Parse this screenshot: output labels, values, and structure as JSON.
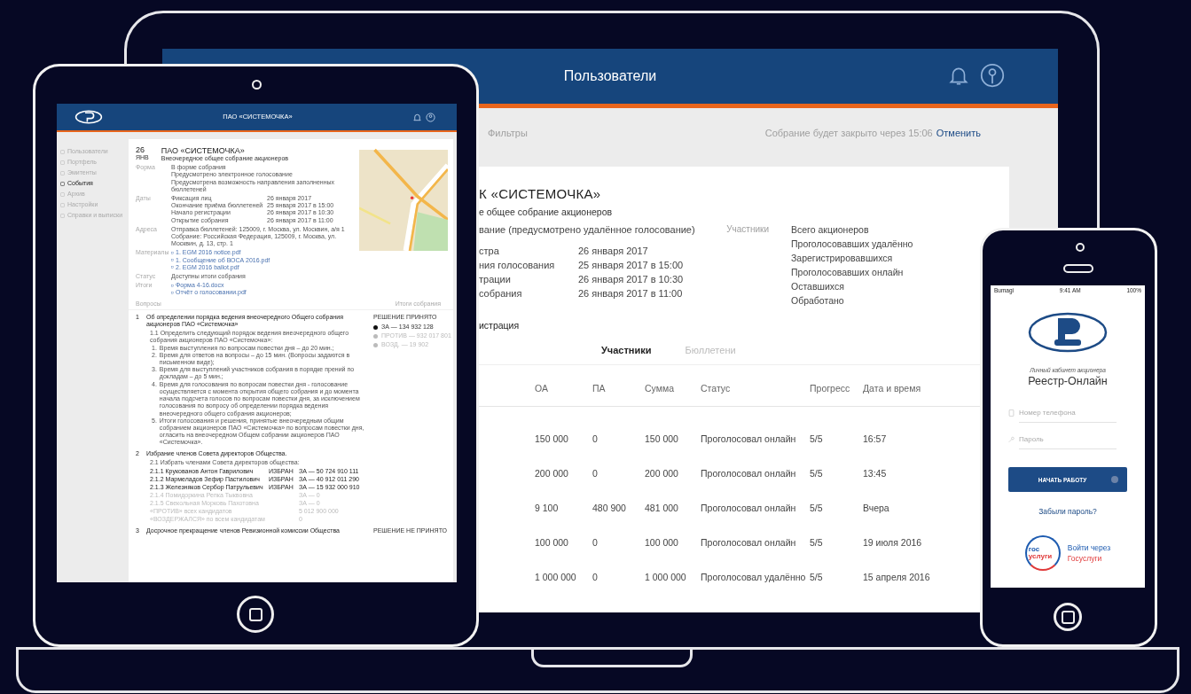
{
  "laptop": {
    "header_title": "Пользователи",
    "filters_label": "Фильтры",
    "timer_text": "Собрание будет закрыто через 15:06",
    "cancel_link": "Отменить",
    "meeting_title": "К «СИСТЕМОЧКА»",
    "meeting_subtitle": "е общее собрание акционеров",
    "meeting_form": "вание (предусмотрено удалённое голосование)",
    "participants_label": "Участники",
    "dates": [
      {
        "label": "стра",
        "value": "26 января 2017"
      },
      {
        "label": "ния голосования",
        "value": "25 января 2017 в 15:00"
      },
      {
        "label": "трации",
        "value": "26 января 2017 в 10:30"
      },
      {
        "label": "собрания",
        "value": "26 января 2017 в 11:00"
      }
    ],
    "section_label": "истрация",
    "stats": [
      "Всего акционеров",
      "Проголосовавших удалённо",
      "Зарегистрировавшихся",
      "Проголосовавших онлайн",
      "Оставшихся",
      "Обработано"
    ],
    "tabs": [
      {
        "label": "Участники",
        "selected": true
      },
      {
        "label": "Бюллетени",
        "selected": false
      }
    ],
    "table": {
      "columns": [
        "ОА",
        "ПА",
        "Сумма",
        "Статус",
        "Прогресс",
        "Дата и время"
      ],
      "rows": [
        [
          "150 000",
          "0",
          "150 000",
          "Проголосовал онлайн",
          "5/5",
          "16:57"
        ],
        [
          "200 000",
          "0",
          "200 000",
          "Проголосовал онлайн",
          "5/5",
          "13:45"
        ],
        [
          "9 100",
          "480 900",
          "481 000",
          "Проголосовал онлайн",
          "5/5",
          "Вчера"
        ],
        [
          "100 000",
          "0",
          "100 000",
          "Проголосовал онлайн",
          "5/5",
          "19 июля 2016"
        ],
        [
          "1 000 000",
          "0",
          "1 000 000",
          "Проголосовал удалённо",
          "5/5",
          "15 апреля 2016"
        ]
      ]
    }
  },
  "tablet": {
    "header_title": "ПАО «СИСТЕМОЧКА»",
    "menu": [
      {
        "label": "Пользователи",
        "selected": false
      },
      {
        "label": "Портфель",
        "selected": false
      },
      {
        "label": "Эмитенты",
        "selected": false
      },
      {
        "label": "События",
        "selected": true
      },
      {
        "label": "Архив",
        "selected": false
      },
      {
        "label": "Настройки",
        "selected": false
      },
      {
        "label": "Справки и выписки",
        "selected": false
      }
    ],
    "event": {
      "day": "26",
      "month": "ЯНВ",
      "title": "ПАО «СИСТЕМОЧКА»",
      "subtitle": "Внеочередное общее собрание акционеров",
      "form_label": "Форма",
      "form_lines": [
        "В форме собрания",
        "Предусмотрено электронное голосование",
        "Предусмотрена возможность направления заполненных бюллетеней"
      ],
      "dates_label": "Даты",
      "dates": [
        {
          "label": "Фиксация лиц",
          "value": "26 января 2017"
        },
        {
          "label": "Окончание приёма бюллетеней",
          "value": "25 января 2017 в 15:00"
        },
        {
          "label": "Начало регистрации",
          "value": "26 января 2017 в 10:30"
        },
        {
          "label": "Открытие собрания",
          "value": "26 января 2017 в 11:00"
        }
      ],
      "address_label": "Адреса",
      "address": "Отправка бюллетеней: 125009, г. Москва, ул. Москвин, а/я 1 Собрание: Российская Федерация, 125009, г. Москва, ул. Москвин, д. 13, стр. 1",
      "materials_label": "Материалы",
      "materials": [
        "1. EGM 2016 notice.pdf",
        "1. Сообщение об ВОСА 2016.pdf",
        "2. EGM 2016 ballot.pdf"
      ],
      "status_label": "Статус",
      "status": "Доступны итоги собрания",
      "results_label": "Итоги",
      "results": [
        "Форма 4-16.docx",
        "Отчёт о голосовании.pdf"
      ],
      "questions_label": "Вопросы",
      "results_link": "Итоги собрания"
    },
    "questions": [
      {
        "number": "1",
        "title": "Об определении порядка ведения внеочередного Общего собрания акционеров ПАО «Системочка»",
        "resolution": "РЕШЕНИЕ ПРИНЯТО",
        "votes": [
          {
            "label": "ЗА — 134 932 128",
            "selected": true
          },
          {
            "label": "ПРОТИВ — 932 017 801",
            "selected": false
          },
          {
            "label": "ВОЗД. — 19 902",
            "selected": false
          }
        ],
        "intro": "1.1 Определить следующий порядок ведения внеочередного общего собрания акционеров ПАО «Системочка»:",
        "items": [
          {
            "number": "1.",
            "text": "Время выступления по вопросам повестки дня – до 20 мин.;"
          },
          {
            "number": "2.",
            "text": "Время для ответов на вопросы – до 15 мин. (Вопросы задаются в письменном виде);"
          },
          {
            "number": "3.",
            "text": "Время для выступлений участников собрания в порядке прений по докладам – до 5 мин.;"
          },
          {
            "number": "4.",
            "text": "Время для голосования по вопросам повестки дня - голосование осуществляется с момента открытия общего собрания и до момента начала подсчета голосов по вопросам повестки дня, за исключением голосования по вопросу об определении порядка ведения внеочередного общего собрания акционеров;"
          },
          {
            "number": "5.",
            "text": "Итоги голосования и решения, принятые внеочередным общим собранием акционеров ПАО «Системочка» по вопросам повестки дня, огласить на внеочередном Общем собрании акционеров ПАО «Системочка»."
          }
        ]
      },
      {
        "number": "2",
        "title": "Избрание членов Совета директоров Общества.",
        "intro": "2.1 Избрать членами Совета директоров общества:",
        "candidates": [
          {
            "name": "2.1.1 Крукованов Антон Гаврилович",
            "status": "ИЗБРАН",
            "votes": "ЗА — 50 724 910 111",
            "elected": true
          },
          {
            "name": "2.1.2 Мармеладов Зефир Пастилович",
            "status": "ИЗБРАН",
            "votes": "ЗА — 40 912 011 290",
            "elected": true
          },
          {
            "name": "2.1.3 Железняков Сербор Патрульевич",
            "status": "ИЗБРАН",
            "votes": "ЗА — 15 932 000 910",
            "elected": true
          },
          {
            "name": "2.1.4 Помидоркина Репка Тыквовна",
            "votes": "ЗА — 0",
            "elected": false
          },
          {
            "name": "2.1.5 Свекольная Морковь Пахотовна",
            "votes": "ЗА — 0",
            "elected": false
          },
          {
            "name": "«ПРОТИВ» всех кандидатов",
            "votes": "5 012 900 000",
            "elected": false
          },
          {
            "name": "«ВОЗДЕРЖАЛСЯ» по всем кандидатам",
            "votes": "0",
            "elected": false
          }
        ]
      },
      {
        "number": "3",
        "title": "Досрочное прекращение членов Ревизионной комиссии Общества",
        "resolution": "РЕШЕНИЕ НЕ ПРИНЯТО"
      }
    ]
  },
  "phone": {
    "status_bar": {
      "carrier": "Bumagi",
      "time": "9:41 AM",
      "battery": "100%"
    },
    "caption": "Личный кабинет акционера",
    "app_title": "Реестр-Онлайн",
    "phone_placeholder": "Номер телефона",
    "password_placeholder": "Пароль",
    "start_button": "НАЧАТЬ РАБОТУ",
    "forgot_link": "Забыли пароль?",
    "gos_logo": [
      "гос",
      "услуги"
    ],
    "gos_link": [
      "Войти через",
      "Госуслуги"
    ]
  }
}
